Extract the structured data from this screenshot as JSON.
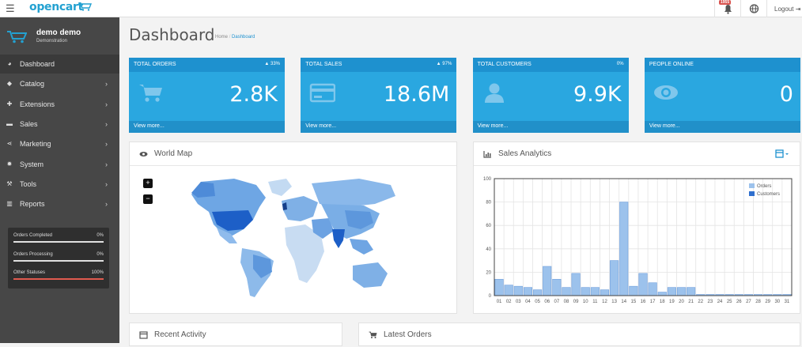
{
  "header": {
    "logo": "opencart",
    "notification_count": "1955",
    "logout": "Logout"
  },
  "user": {
    "name": "demo demo",
    "role": "Demonstration"
  },
  "sidebar": {
    "items": [
      {
        "label": "Dashboard",
        "icon": "dashboard-icon",
        "active": true
      },
      {
        "label": "Catalog",
        "icon": "tag-icon"
      },
      {
        "label": "Extensions",
        "icon": "puzzle-icon"
      },
      {
        "label": "Sales",
        "icon": "cart-icon"
      },
      {
        "label": "Marketing",
        "icon": "share-icon"
      },
      {
        "label": "System",
        "icon": "gear-icon"
      },
      {
        "label": "Tools",
        "icon": "wrench-icon"
      },
      {
        "label": "Reports",
        "icon": "bar-chart-icon"
      }
    ],
    "stats": [
      {
        "label": "Orders Completed",
        "value": "0%",
        "fraction": 0.0,
        "color": "#e0e0e0"
      },
      {
        "label": "Orders Processing",
        "value": "0%",
        "fraction": 0.0,
        "color": "#e0e0e0"
      },
      {
        "label": "Other Statuses",
        "value": "100%",
        "fraction": 1.0,
        "color": "#e05a4f"
      }
    ]
  },
  "page": {
    "title": "Dashboard",
    "breadcrumb": [
      "Home",
      "Dashboard"
    ]
  },
  "tiles": [
    {
      "title": "TOTAL ORDERS",
      "change": "▲ 33%",
      "value": "2.8K",
      "link": "View more...",
      "icon": "cart-icon"
    },
    {
      "title": "TOTAL SALES",
      "change": "▲ 97%",
      "value": "18.6M",
      "link": "View more...",
      "icon": "credit-card-icon"
    },
    {
      "title": "TOTAL CUSTOMERS",
      "change": "0%",
      "value": "9.9K",
      "link": "View more...",
      "icon": "user-icon"
    },
    {
      "title": "PEOPLE ONLINE",
      "change": "",
      "value": "0",
      "link": "View more...",
      "icon": "eye-icon"
    }
  ],
  "panels": {
    "world_map": "World Map",
    "sales_analytics": "Sales Analytics",
    "recent_activity": "Recent Activity",
    "latest_orders": "Latest Orders"
  },
  "colors": {
    "accent": "#1e91cf",
    "tile": "#2aa7e0",
    "sidebar": "#474747"
  },
  "chart_data": {
    "type": "bar",
    "categories": [
      "01",
      "02",
      "03",
      "04",
      "05",
      "06",
      "07",
      "08",
      "09",
      "10",
      "11",
      "12",
      "13",
      "14",
      "15",
      "16",
      "17",
      "18",
      "19",
      "20",
      "21",
      "22",
      "23",
      "24",
      "25",
      "26",
      "27",
      "28",
      "29",
      "30",
      "31"
    ],
    "series": [
      {
        "name": "Orders",
        "values": [
          14,
          9,
          8,
          7,
          5,
          25,
          14,
          7,
          19,
          7,
          7,
          5,
          30,
          80,
          8,
          19,
          11,
          3,
          7,
          7,
          7,
          1,
          1,
          1,
          1,
          1,
          1,
          1,
          1,
          1,
          1
        ]
      },
      {
        "name": "Customers",
        "values": [
          0,
          0,
          0,
          0,
          0,
          0,
          0,
          0,
          0,
          0,
          0,
          0,
          0,
          0,
          0,
          0,
          0,
          0,
          0,
          0,
          0,
          0,
          0,
          0,
          0,
          0,
          0,
          0,
          0,
          0,
          0
        ]
      }
    ],
    "ylim": [
      0,
      100
    ],
    "yticks": [
      0,
      20,
      40,
      60,
      80,
      100
    ],
    "grid": true,
    "legend_position": "top-right",
    "colors": [
      "#9cc2ec",
      "#2f6fce"
    ]
  }
}
